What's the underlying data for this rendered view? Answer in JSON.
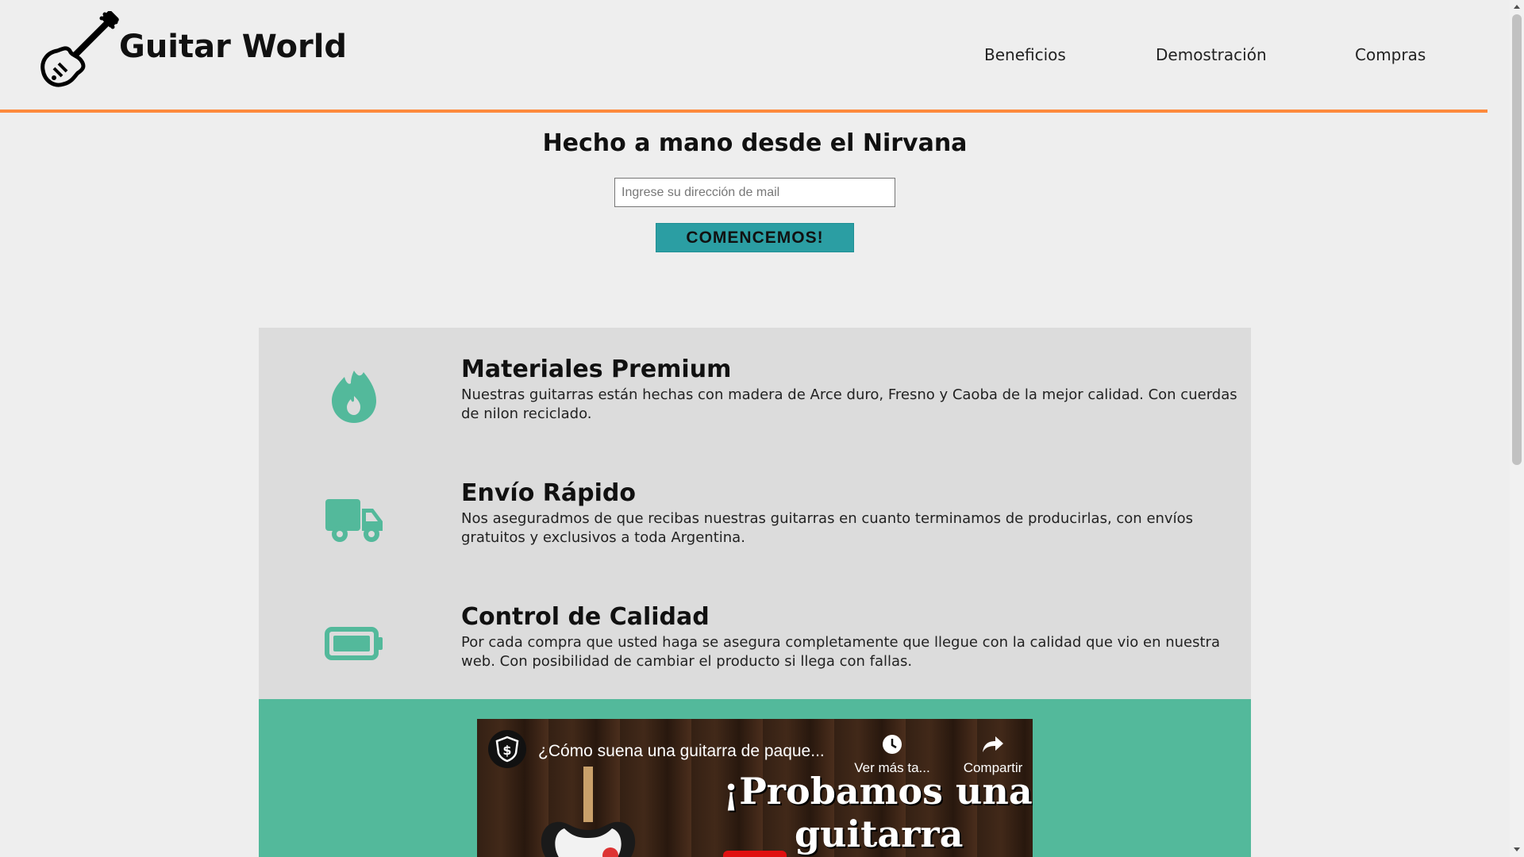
{
  "header": {
    "brand": "Guitar World",
    "logo_icon": "guitar-icon",
    "nav": [
      {
        "label": "Beneficios"
      },
      {
        "label": "Demostración"
      },
      {
        "label": "Compras"
      }
    ],
    "accent_color": "#fd8a3c"
  },
  "hero": {
    "title": "Hecho a mano desde el Nirvana",
    "email_placeholder": "Ingrese su dirección de mail",
    "cta_label": "COMENCEMOS!",
    "cta_color": "#2b9ea3"
  },
  "features": [
    {
      "icon": "fire-icon",
      "title": "Materiales Premium",
      "description": "Nuestras guitarras están hechas con madera de Arce duro, Fresno y Caoba de la mejor calidad. Con cuerdas de nilon reciclado."
    },
    {
      "icon": "truck-icon",
      "title": "Envío Rápido",
      "description": "Nos aseguradmos de que recibas nuestras guitarras en cuanto terminamos de producirlas, con envíos gratuitos y exclusivos a toda Argentina."
    },
    {
      "icon": "battery-full-icon",
      "title": "Control de Calidad",
      "description": "Por cada compra que usted haga se asegura completamente que llegue con la calidad que vio en nuestra web. Con posibilidad de cambiar el producto si llega con fallas."
    }
  ],
  "icon_color": "#53b99b",
  "video": {
    "title": "¿Cómo suena una guitarra de paque...",
    "watch_later_label": "Ver más ta...",
    "share_label": "Compartir",
    "promo_line1": "¡Probamos una",
    "promo_line2": "guitarra",
    "section_color": "#53b99b"
  }
}
